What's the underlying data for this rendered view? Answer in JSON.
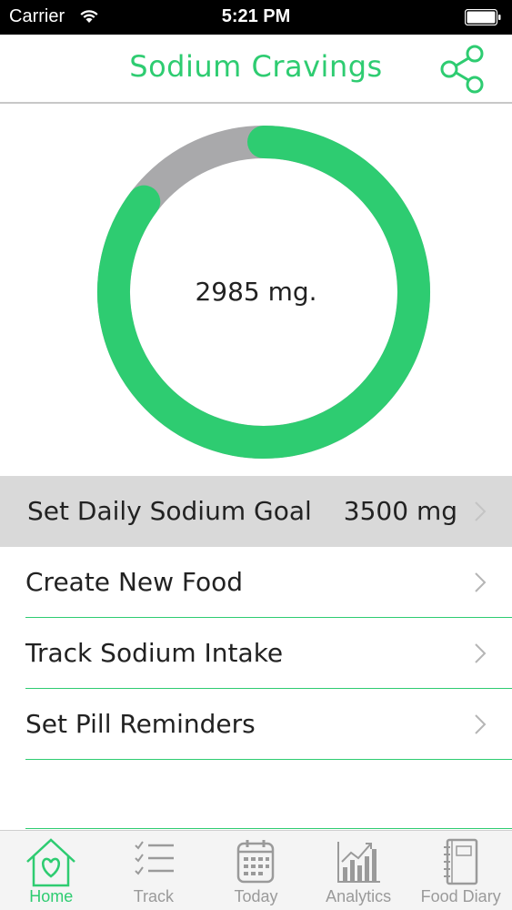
{
  "status_bar": {
    "carrier": "Carrier",
    "time": "5:21 PM"
  },
  "nav": {
    "title": "Sodium Cravings"
  },
  "ring": {
    "value_label": "2985 mg.",
    "consumed_mg": 2985,
    "goal_mg": 3500
  },
  "menu": {
    "items": [
      {
        "label": "Set Daily Sodium Goal",
        "value": "3500 mg",
        "selected": true
      },
      {
        "label": "Create New Food",
        "value": ""
      },
      {
        "label": "Track Sodium Intake",
        "value": ""
      },
      {
        "label": "Set Pill Reminders",
        "value": ""
      }
    ]
  },
  "tabs": [
    {
      "label": "Home",
      "icon": "home-heart-icon",
      "active": true
    },
    {
      "label": "Track",
      "icon": "checklist-icon"
    },
    {
      "label": "Today",
      "icon": "calendar-icon"
    },
    {
      "label": "Analytics",
      "icon": "analytics-chart-icon"
    },
    {
      "label": "Food Diary",
      "icon": "notebook-icon"
    }
  ],
  "colors": {
    "accent": "#2ecc71",
    "ring_track": "#a9a9ab",
    "selected_row": "#d9d9d9",
    "tab_inactive": "#9a9a9a"
  }
}
